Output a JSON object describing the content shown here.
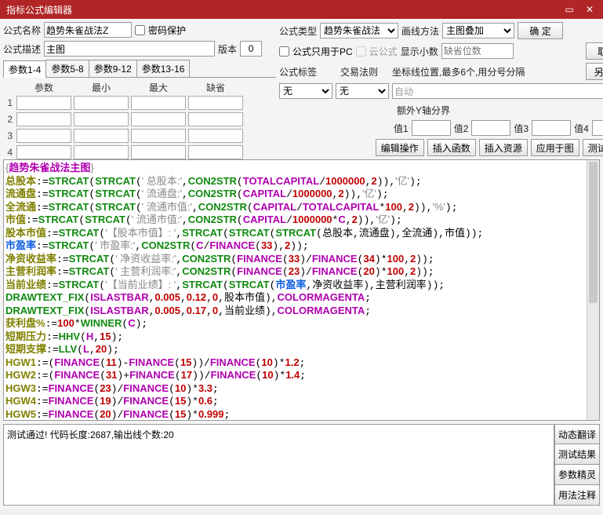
{
  "window": {
    "title": "指标公式编辑器"
  },
  "labels": {
    "name": "公式名称",
    "desc": "公式描述",
    "pwd": "密码保护",
    "type": "公式类型",
    "lineMethod": "画线方法",
    "version": "版本",
    "pcOnly": "公式只用于PC",
    "cloud": "云公式",
    "decimal": "显示小数",
    "decPlaces": "缺省位数",
    "tag": "公式标签",
    "tradeRule": "交易法则",
    "coordHint": "坐标线位置,最多6个,用分号分隔",
    "auto": "自动",
    "extraY": "额外Y轴分界",
    "v1": "值1",
    "v2": "值2",
    "v3": "值3",
    "v4": "值4"
  },
  "values": {
    "name": "趋势朱雀战法Z",
    "desc": "主图",
    "version": "0",
    "type": "趋势朱雀战法",
    "lineMethod": "主图叠加",
    "tag": "无",
    "tradeRule": "无",
    "decPlaces": ""
  },
  "buttons": {
    "ok": "确 定",
    "cancel": "取 消",
    "saveAs": "另存为",
    "editOp": "编辑操作",
    "insFunc": "插入函数",
    "insRes": "插入资源",
    "applyChart": "应用于图",
    "testFormula": "测试公式",
    "dynTrans": "动态翻译",
    "testResult": "测试结果",
    "paramWiz": "参数精灵",
    "usage": "用法注释"
  },
  "paramTabs": [
    "参数1-4",
    "参数5-8",
    "参数9-12",
    "参数13-16"
  ],
  "paramHeaders": [
    "参数",
    "最小",
    "最大",
    "缺省"
  ],
  "paramRows": [
    "1",
    "2",
    "3",
    "4"
  ],
  "status": "测试通过! 代码长度:2687,输出线个数:20",
  "codeTitle": "趋势朱雀战法主图"
}
